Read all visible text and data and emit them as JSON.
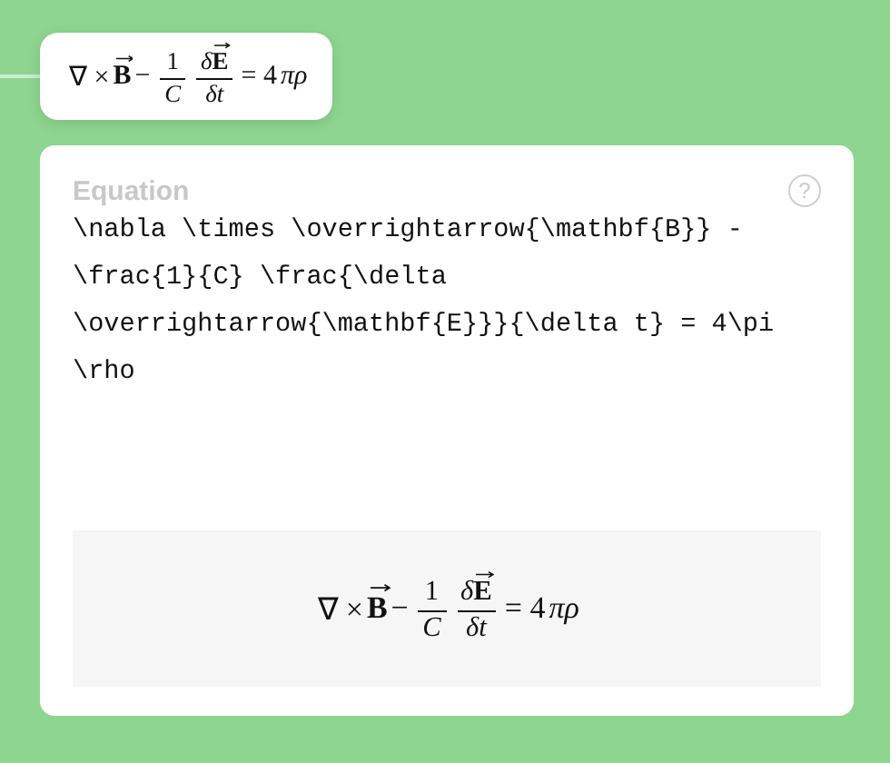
{
  "inline_equation": {
    "parts": [
      {
        "kind": "op",
        "text": "∇ ×"
      },
      {
        "kind": "vector",
        "text": "B"
      },
      {
        "kind": "op",
        "text": "−"
      },
      {
        "kind": "frac",
        "num": [
          {
            "kind": "op",
            "text": "1"
          }
        ],
        "den": [
          {
            "kind": "var",
            "text": "C"
          }
        ]
      },
      {
        "kind": "frac",
        "num": [
          {
            "kind": "var",
            "text": "δ"
          },
          {
            "kind": "vector",
            "text": "E"
          }
        ],
        "den": [
          {
            "kind": "var",
            "text": "δt"
          }
        ]
      },
      {
        "kind": "op",
        "text": "= 4"
      },
      {
        "kind": "var",
        "text": "πρ"
      }
    ]
  },
  "editor": {
    "title": "Equation",
    "help": "?",
    "source": "\\nabla \\times \\overrightarrow{\\mathbf{B}} - \\frac{1}{C} \\frac{\\delta \\overrightarrow{\\mathbf{E}}}{\\delta t} = 4\\pi \\rho"
  },
  "preview_equation": {
    "parts": [
      {
        "kind": "op",
        "text": "∇ ×"
      },
      {
        "kind": "vector",
        "text": "B"
      },
      {
        "kind": "op",
        "text": "−"
      },
      {
        "kind": "frac",
        "num": [
          {
            "kind": "op",
            "text": "1"
          }
        ],
        "den": [
          {
            "kind": "var",
            "text": "C"
          }
        ]
      },
      {
        "kind": "frac",
        "num": [
          {
            "kind": "var",
            "text": "δ"
          },
          {
            "kind": "vector",
            "text": "E"
          }
        ],
        "den": [
          {
            "kind": "var",
            "text": "δt"
          }
        ]
      },
      {
        "kind": "op",
        "text": "= 4"
      },
      {
        "kind": "var",
        "text": "πρ"
      }
    ]
  }
}
